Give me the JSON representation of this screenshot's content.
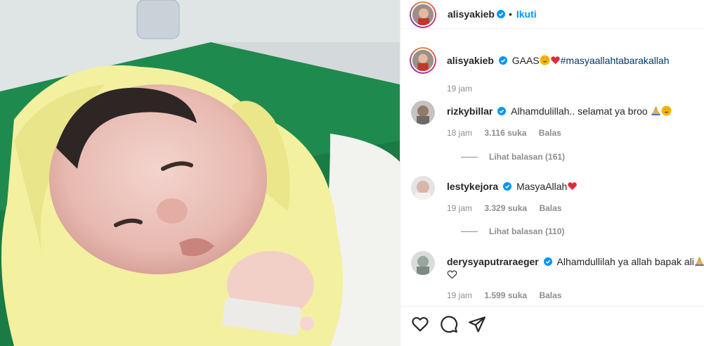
{
  "post": {
    "username": "alisyakieb",
    "separator": "•",
    "follow_label": "Ikuti"
  },
  "caption": {
    "username": "alisyakieb",
    "text": "GAAS",
    "hashtag": "#masyaallahtabarakallah",
    "time": "19 jam"
  },
  "comments": [
    {
      "username": "rizkybillar",
      "text": "Alhamdulillah.. selamat ya broo",
      "time": "18 jam",
      "likes": "3.116 suka",
      "reply_label": "Balas",
      "view_replies": "Lihat balasan (161)"
    },
    {
      "username": "lestykejora",
      "text": "MasyaAllah",
      "time": "19 jam",
      "likes": "3.329 suka",
      "reply_label": "Balas",
      "view_replies": "Lihat balasan (110)"
    },
    {
      "username": "derysyaputraraeger",
      "text": "Alhamdullilah ya allah bapak ali",
      "time": "19 jam",
      "likes": "1.599 suka",
      "reply_label": "Balas"
    }
  ],
  "icons": {
    "verified": "verified-badge-icon",
    "like": "heart-icon",
    "comment": "comment-icon",
    "share": "share-icon"
  },
  "colors": {
    "link": "#0095f6",
    "hashtag": "#00376b",
    "verified": "#0095f6",
    "muted": "#8e8e8e"
  }
}
